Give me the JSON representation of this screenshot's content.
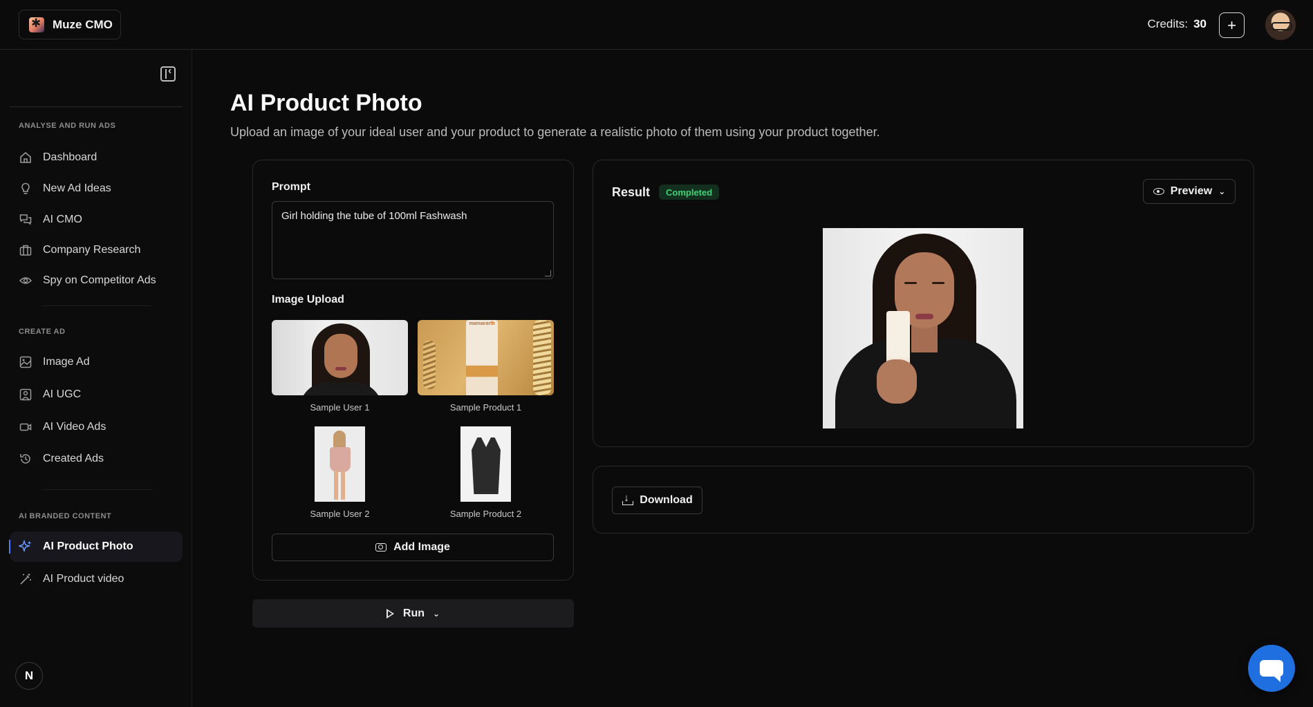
{
  "header": {
    "brand_name": "Muze CMO",
    "credits_label": "Credits:",
    "credits_value": "30",
    "add_label": "+"
  },
  "sidebar": {
    "sections": [
      {
        "label": "ANALYSE AND RUN ADS",
        "items": [
          {
            "label": "Dashboard",
            "icon": "home-icon"
          },
          {
            "label": "New Ad Ideas",
            "icon": "lightbulb-icon"
          },
          {
            "label": "AI CMO",
            "icon": "chat-bubbles-icon"
          },
          {
            "label": "Company Research",
            "icon": "building-icon"
          },
          {
            "label": "Spy on Competitor Ads",
            "icon": "eye-icon"
          }
        ]
      },
      {
        "label": "CREATE AD",
        "items": [
          {
            "label": "Image Ad",
            "icon": "image-icon"
          },
          {
            "label": "AI UGC",
            "icon": "user-square-icon"
          },
          {
            "label": "AI Video Ads",
            "icon": "video-camera-icon"
          },
          {
            "label": "Created Ads",
            "icon": "history-icon"
          }
        ]
      },
      {
        "label": "AI BRANDED CONTENT",
        "items": [
          {
            "label": "AI Product Photo",
            "icon": "sparkles-icon",
            "active": true
          },
          {
            "label": "AI Product video",
            "icon": "magic-wand-icon"
          }
        ]
      }
    ],
    "footer_badge": "N"
  },
  "main": {
    "title": "AI Product Photo",
    "subtitle": "Upload an image of your ideal user and your product to generate a realistic photo of them using your product together.",
    "prompt_label": "Prompt",
    "prompt_value": "Girl holding the tube of 100ml Fashwash",
    "upload_label": "Image Upload",
    "samples": [
      {
        "caption": "Sample User 1"
      },
      {
        "caption": "Sample Product 1"
      },
      {
        "caption": "Sample User 2"
      },
      {
        "caption": "Sample Product 2"
      }
    ],
    "product_brand_text": "mamaearth",
    "add_image_label": "Add Image",
    "run_label": "Run"
  },
  "result": {
    "label": "Result",
    "status": "Completed",
    "preview_label": "Preview",
    "download_label": "Download"
  },
  "colors": {
    "accent": "#4f7cff",
    "status_green": "#3fd17a",
    "chat_fab": "#1f6fe0"
  }
}
